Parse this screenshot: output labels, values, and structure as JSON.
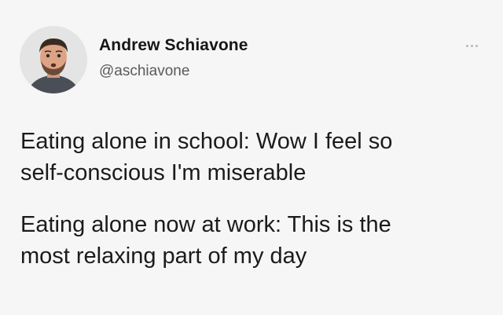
{
  "author": {
    "name": "Andrew Schiavone",
    "handle": "@aschiavone",
    "avatar_icon": "user-avatar-photo"
  },
  "more_icon": "more-horizontal-icon",
  "tweet": {
    "paragraphs": [
      "Eating alone in school:  Wow I feel so\nself-conscious I'm miserable",
      "Eating alone now at work:  This is the\nmost relaxing part of my day"
    ]
  },
  "colors": {
    "background": "#f6f6f6",
    "text": "#1b1b1b",
    "handle": "#5a5a5a"
  }
}
